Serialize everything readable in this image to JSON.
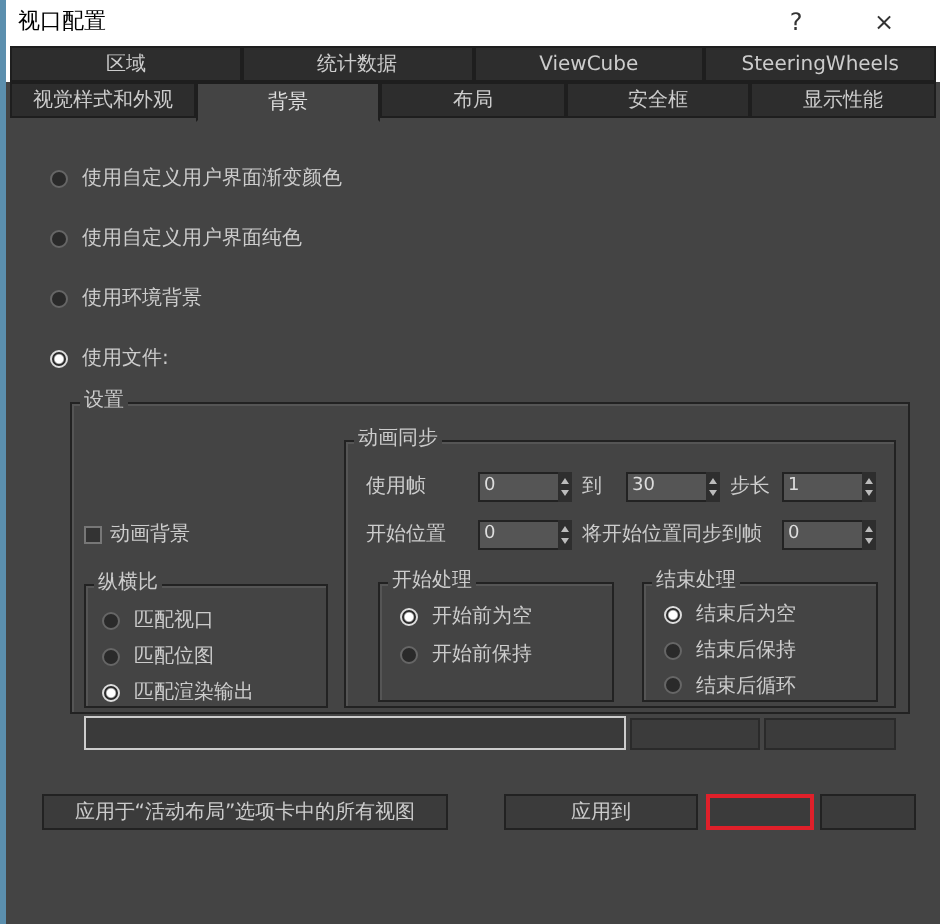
{
  "window": {
    "title": "视口配置",
    "help": "?",
    "close": "×"
  },
  "tab_rows": [
    [
      {
        "label": "区域",
        "selected": false
      },
      {
        "label": "统计数据",
        "selected": false
      },
      {
        "label": "ViewCube",
        "selected": false
      },
      {
        "label": "SteeringWheels",
        "selected": false
      }
    ],
    [
      {
        "label": "视觉样式和外观",
        "selected": false
      },
      {
        "label": "背景",
        "selected": true
      },
      {
        "label": "布局",
        "selected": false
      },
      {
        "label": "安全框",
        "selected": false
      },
      {
        "label": "显示性能",
        "selected": false
      }
    ]
  ],
  "background_options": [
    {
      "label": "使用自定义用户界面渐变颜色",
      "selected": false
    },
    {
      "label": "使用自定义用户界面纯色",
      "selected": false
    },
    {
      "label": "使用环境背景",
      "selected": false
    },
    {
      "label": "使用文件:",
      "selected": true
    }
  ],
  "settings": {
    "title": "设置",
    "animate_background": {
      "label": "动画背景",
      "checked": false
    },
    "aspect_ratio": {
      "title": "纵横比",
      "options": [
        {
          "label": "匹配视口",
          "selected": false
        },
        {
          "label": "匹配位图",
          "selected": false
        },
        {
          "label": "匹配渲染输出",
          "selected": true
        }
      ]
    },
    "animation_sync": {
      "title": "动画同步",
      "use_frames": {
        "label": "使用帧",
        "value": "0"
      },
      "to_frame": {
        "label": "到",
        "value": "30"
      },
      "step": {
        "label": "步长",
        "value": "1"
      },
      "start_position": {
        "label": "开始位置",
        "value": "0"
      },
      "sync_start_to_frame": {
        "label": "将开始位置同步到帧",
        "value": "0"
      },
      "start_processing": {
        "title": "开始处理",
        "options": [
          {
            "label": "开始前为空",
            "selected": true
          },
          {
            "label": "开始前保持",
            "selected": false
          }
        ]
      },
      "end_processing": {
        "title": "结束处理",
        "options": [
          {
            "label": "结束后为空",
            "selected": true
          },
          {
            "label": "结束后保持",
            "selected": false
          },
          {
            "label": "结束后循环",
            "selected": false
          }
        ]
      }
    },
    "file_buttons": [
      {
        "kind": "blank"
      },
      {
        "kind": "blank"
      }
    ]
  },
  "bottom_buttons": [
    {
      "kind": "text",
      "label": "应用于“活动布局”选项卡中的所有视图",
      "highlighted": false
    },
    {
      "kind": "text",
      "label": "应用到",
      "highlighted": false
    },
    {
      "kind": "blank",
      "highlighted": true
    },
    {
      "kind": "blank",
      "highlighted": false
    }
  ]
}
